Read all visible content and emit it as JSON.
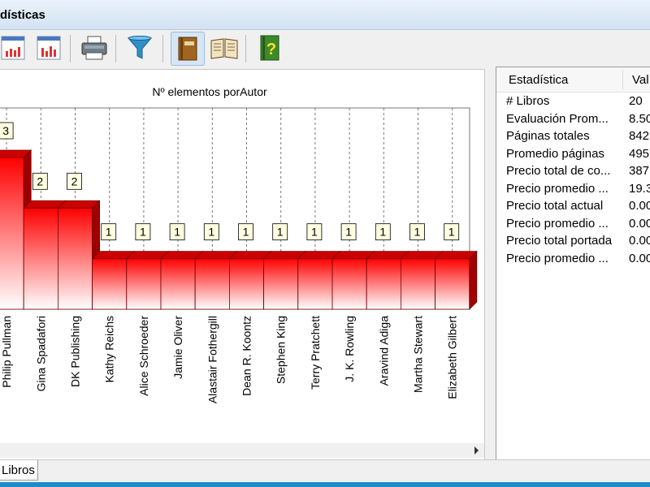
{
  "window": {
    "title": "dísticas"
  },
  "toolbar": {
    "buttons": [
      {
        "name": "bar-chart-button",
        "icon": "bar-chart-icon"
      },
      {
        "name": "column-chart-button",
        "icon": "column-chart-icon"
      },
      {
        "name": "print-button",
        "icon": "printer-icon"
      },
      {
        "name": "filter-button",
        "icon": "funnel-icon"
      },
      {
        "name": "book-button",
        "icon": "book-icon"
      },
      {
        "name": "open-book-button",
        "icon": "open-book-icon"
      },
      {
        "name": "help-button",
        "icon": "help-book-icon"
      }
    ]
  },
  "chart_data": {
    "type": "bar",
    "title": "Nº elementos porAutor",
    "categories": [
      "Philip Pullman",
      "Gina Spadafori",
      "DK Publishing",
      "Kathy Reichs",
      "Alice Schroeder",
      "Jamie Oliver",
      "Alastair Fothergill",
      "Dean R. Koontz",
      "Stephen King",
      "Terry Pratchett",
      "J. K. Rowling",
      "Aravind Adiga",
      "Martha Stewart",
      "Elizabeth Gilbert"
    ],
    "values": [
      3,
      2,
      2,
      1,
      1,
      1,
      1,
      1,
      1,
      1,
      1,
      1,
      1,
      1
    ],
    "data_labels": [
      "3",
      "2",
      "2",
      "1",
      "1",
      "1",
      "1",
      "1",
      "1",
      "1",
      "1",
      "1",
      "1",
      "1"
    ],
    "ylim": [
      0,
      3.5
    ],
    "grid": true,
    "colors": {
      "bar_top": "#ff0000",
      "bar_bottom": "#ffffff",
      "bar_side": "#a00000",
      "label_bg": "#ffffe1"
    }
  },
  "stats": {
    "headers": [
      "Estadística",
      "Val"
    ],
    "rows": [
      {
        "label": "# Libros",
        "value": "20"
      },
      {
        "label": "Evaluación Prom...",
        "value": "8.50"
      },
      {
        "label": "Páginas totales",
        "value": "842"
      },
      {
        "label": "Promedio páginas",
        "value": "495"
      },
      {
        "label": "Precio total de co...",
        "value": "387"
      },
      {
        "label": "Precio promedio ...",
        "value": "19.3"
      },
      {
        "label": "Precio total actual",
        "value": "0.00"
      },
      {
        "label": "Precio promedio ...",
        "value": "0.00"
      },
      {
        "label": "Precio total portada",
        "value": "0.00"
      },
      {
        "label": "Precio promedio ...",
        "value": "0.00"
      }
    ]
  },
  "statusbar": {
    "tab_label": "Libros"
  }
}
